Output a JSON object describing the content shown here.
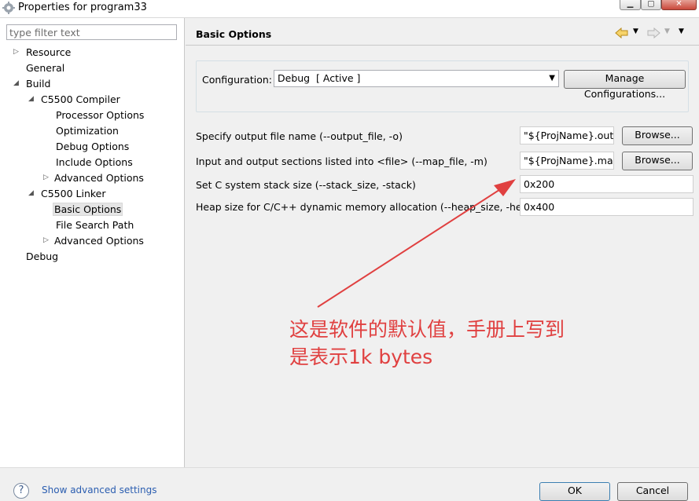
{
  "window": {
    "title": "Properties for program33",
    "controls": [
      "minimize",
      "maximize",
      "close"
    ]
  },
  "sidebar": {
    "filter_placeholder": "type filter text",
    "items": [
      {
        "label": "Resource",
        "expandable": true,
        "expanded": false
      },
      {
        "label": "General"
      },
      {
        "label": "Build",
        "expandable": true,
        "expanded": true
      },
      {
        "label": "C5500 Compiler",
        "expandable": true,
        "expanded": true
      },
      {
        "label": "Processor Options"
      },
      {
        "label": "Optimization"
      },
      {
        "label": "Debug Options"
      },
      {
        "label": "Include Options"
      },
      {
        "label": "Advanced Options",
        "expandable": true,
        "expanded": false
      },
      {
        "label": "C5500 Linker",
        "expandable": true,
        "expanded": true
      },
      {
        "label": "Basic Options",
        "selected": true
      },
      {
        "label": "File Search Path"
      },
      {
        "label": "Advanced Options",
        "expandable": true,
        "expanded": false
      },
      {
        "label": "Debug"
      }
    ]
  },
  "main": {
    "title": "Basic Options",
    "nav_icons": [
      "back-arrow-icon",
      "chevron-down-icon",
      "forward-arrow-icon",
      "chevron-down-icon",
      "view-menu-icon"
    ],
    "configuration": {
      "label": "Configuration:",
      "value": "Debug  [ Active ]",
      "manage_button": "Manage Configurations..."
    },
    "fields": [
      {
        "label": "Specify output file name (--output_file, -o)",
        "value": "\"${ProjName}.out\"",
        "browse": "Browse..."
      },
      {
        "label": "Input and output sections listed into <file> (--map_file, -m)",
        "value": "\"${ProjName}.map\"",
        "browse": "Browse..."
      },
      {
        "label": "Set C system stack size (--stack_size, -stack)",
        "value": "0x200"
      },
      {
        "label": "Heap size for C/C++ dynamic memory allocation (--heap_size, -heap)",
        "value": "0x400"
      }
    ]
  },
  "annotation": {
    "line1": "这是软件的默认值，手册上写到",
    "line2": "是表示1k bytes",
    "color": "#e04040"
  },
  "footer": {
    "help_link": "Show advanced settings",
    "ok_button": "OK",
    "cancel_button": "Cancel"
  }
}
